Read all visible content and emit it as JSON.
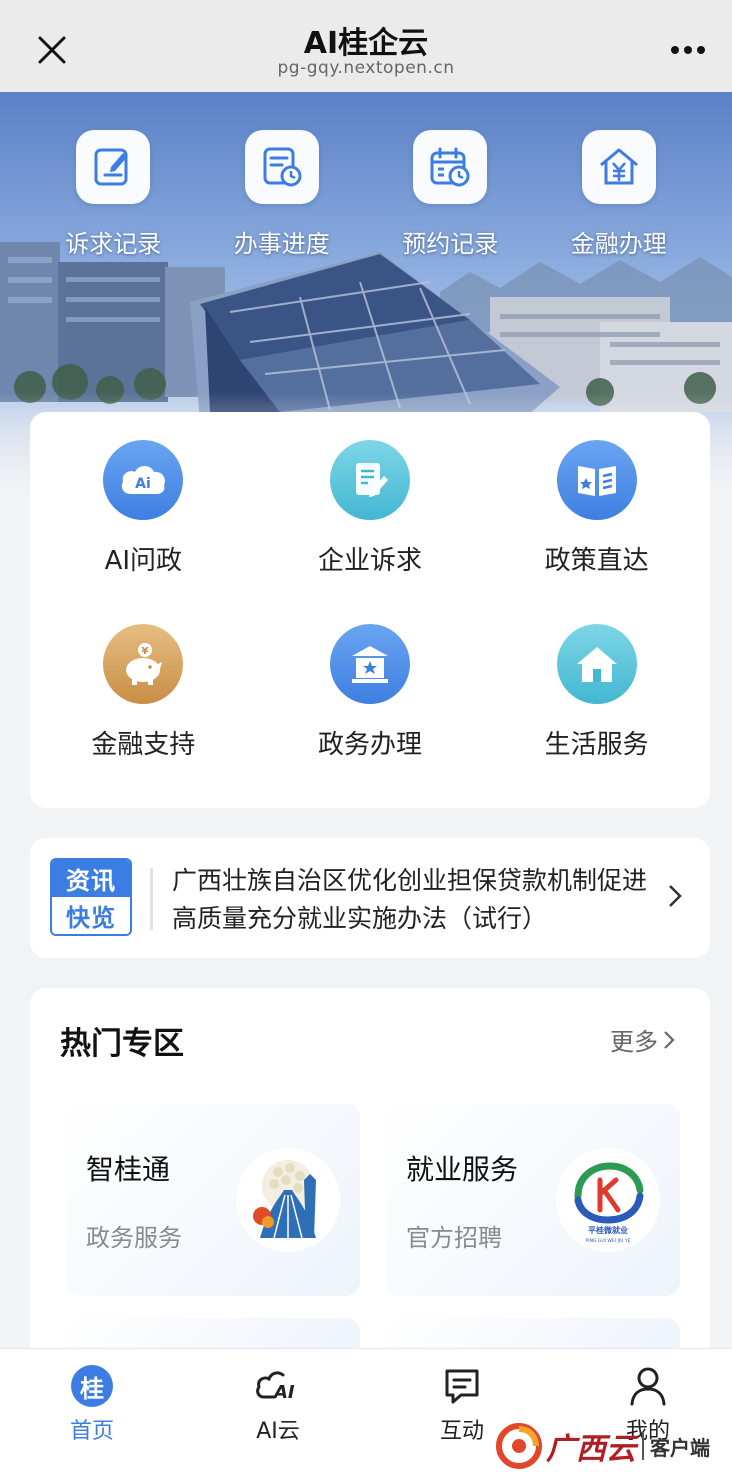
{
  "topbar": {
    "title": "AI桂企云",
    "url": "pg-gqy.nextopen.cn",
    "close_icon": "close-icon",
    "more_icon": "more-dots-icon"
  },
  "quick_actions": [
    {
      "label": "诉求记录",
      "icon": "edit-record-icon"
    },
    {
      "label": "办事进度",
      "icon": "progress-doc-icon"
    },
    {
      "label": "预约记录",
      "icon": "calendar-clock-icon"
    },
    {
      "label": "金融办理",
      "icon": "finance-house-icon"
    }
  ],
  "services": [
    {
      "label": "AI问政",
      "icon": "ai-cloud-icon",
      "color": "#4f8fe8"
    },
    {
      "label": "企业诉求",
      "icon": "document-pen-icon",
      "color": "#53c2d9"
    },
    {
      "label": "政策直达",
      "icon": "policy-book-icon",
      "color": "#4f8fe8"
    },
    {
      "label": "金融支持",
      "icon": "piggy-bank-icon",
      "color": "#d9a35c"
    },
    {
      "label": "政务办理",
      "icon": "government-building-icon",
      "color": "#4f8fe8"
    },
    {
      "label": "生活服务",
      "icon": "house-icon",
      "color": "#53c2d9"
    }
  ],
  "news": {
    "badge_line1": "资讯",
    "badge_line2": "快览",
    "text": "广西壮族自治区优化创业担保贷款机制促进高质量充分就业实施办法（试行）"
  },
  "hot_zone": {
    "title": "热门专区",
    "more_label": "更多",
    "cards": [
      {
        "title": "智桂通",
        "subtitle": "政务服务",
        "icon": "zhiguitong-logo-icon"
      },
      {
        "title": "就业服务",
        "subtitle": "官方招聘",
        "icon": "pingguiwei-logo-icon",
        "logo_text": "平桂微就业",
        "logo_subtext": "PING GUI WEI JIU YE"
      }
    ]
  },
  "tabbar": {
    "tabs": [
      {
        "label": "首页",
        "icon": "gui-home-icon",
        "active": true
      },
      {
        "label": "AI云",
        "icon": "ai-cloud-tab-icon",
        "active": false
      },
      {
        "label": "互动",
        "icon": "chat-bubble-icon",
        "active": false
      },
      {
        "label": "我的",
        "icon": "user-icon",
        "active": false
      }
    ],
    "home_glyph": "桂"
  },
  "watermark": {
    "brand": "广西云",
    "suffix": "客户端"
  },
  "colors": {
    "accent": "#3b7de3",
    "icon_blue": "#4f8fe8",
    "icon_teal": "#53c2d9",
    "icon_gold": "#d9a35c"
  }
}
